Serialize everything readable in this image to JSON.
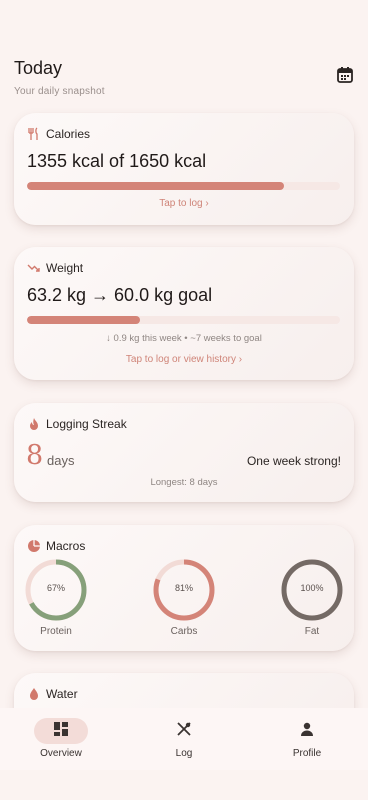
{
  "header": {
    "title": "Today",
    "subtitle": "Your daily snapshot"
  },
  "calories": {
    "title": "Calories",
    "summary": "1355 kcal of 1650 kcal",
    "progress": 0.82,
    "tap_label": "Tap to log  ›"
  },
  "weight": {
    "title": "Weight",
    "summary": "63.2 kg → 60.0 kg goal",
    "progress": 0.36,
    "meta": "↓  0.9 kg this week  •  ~7 weeks to goal",
    "tap_label": "Tap to log or view history  ›"
  },
  "streak": {
    "title": "Logging Streak",
    "count": "8",
    "unit": "days",
    "message": "One week strong!",
    "longest": "Longest: 8 days"
  },
  "macros": {
    "title": "Macros",
    "items": [
      {
        "label": "Protein",
        "pct_text": "67%",
        "value": 0.67,
        "color": "#86a07a"
      },
      {
        "label": "Carbs",
        "pct_text": "81%",
        "value": 0.81,
        "color": "#d48478"
      },
      {
        "label": "Fat",
        "pct_text": "100%",
        "value": 1.0,
        "color": "#746a65"
      }
    ]
  },
  "water": {
    "title": "Water"
  },
  "nav": {
    "items": [
      {
        "label": "Overview",
        "icon": "grid-icon",
        "active": true
      },
      {
        "label": "Log",
        "icon": "utensils-icon",
        "active": false
      },
      {
        "label": "Profile",
        "icon": "person-icon",
        "active": false
      }
    ]
  },
  "colors": {
    "accent": "#d48478",
    "background": "#fbf3f1",
    "success": "#86a07a"
  }
}
